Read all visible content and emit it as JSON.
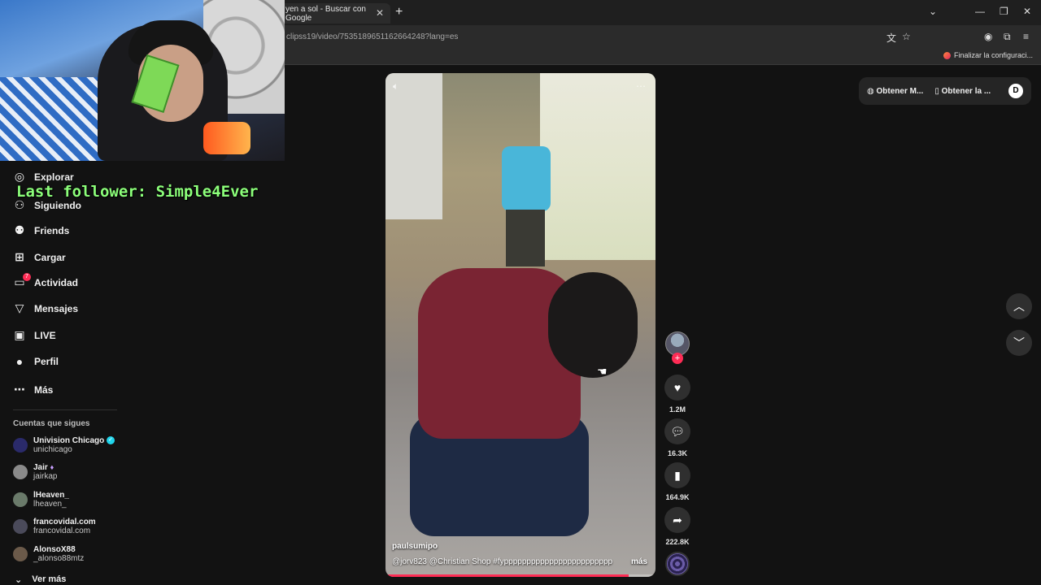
{
  "browser": {
    "tab_title": "yen a sol - Buscar con Google",
    "tab_close": "✕",
    "new_tab": "+",
    "url": "clipss19/video/7535189651162664248?lang=es",
    "bookmark_label": "Finalizar la configuraci..."
  },
  "overlay": {
    "last_follower": "Last follower: Simple4Ever"
  },
  "sidebar": {
    "items": [
      {
        "label": "Explorar",
        "icon": "compass-icon"
      },
      {
        "label": "Siguiendo",
        "icon": "following-icon"
      },
      {
        "label": "Friends",
        "icon": "friends-icon"
      },
      {
        "label": "Cargar",
        "icon": "upload-icon"
      },
      {
        "label": "Actividad",
        "icon": "activity-icon"
      },
      {
        "label": "Mensajes",
        "icon": "messages-icon"
      },
      {
        "label": "LIVE",
        "icon": "live-icon"
      },
      {
        "label": "Perfil",
        "icon": "profile-icon"
      },
      {
        "label": "Más",
        "icon": "more-icon"
      }
    ],
    "activity_badge": "7",
    "following_title": "Cuentas que sigues",
    "accounts": [
      {
        "name": "Univision Chicago",
        "handle": "unichicago"
      },
      {
        "name": "Jair",
        "handle": "jairkap"
      },
      {
        "name": "lHeaven_",
        "handle": "lheaven_"
      },
      {
        "name": "francovidal.com",
        "handle": "francovidal.com"
      },
      {
        "name": "AlonsoX88",
        "handle": "_alonso88mtz"
      }
    ],
    "see_more": "Ver más"
  },
  "video": {
    "author": "paulsumipo",
    "caption": "@jorv823  @Christian Shop  #fypppppppppppppppppppppppp",
    "more": "más",
    "progress": 0.9
  },
  "actions": {
    "likes": "1.2M",
    "comments": "16.3K",
    "saves": "164.9K",
    "shares": "222.8K"
  },
  "top_pill": {
    "item1": "Obtener M...",
    "item2": "Obtener la ..."
  },
  "colors": {
    "accent": "#fe2c55",
    "follower_text": "#8cff7a"
  }
}
